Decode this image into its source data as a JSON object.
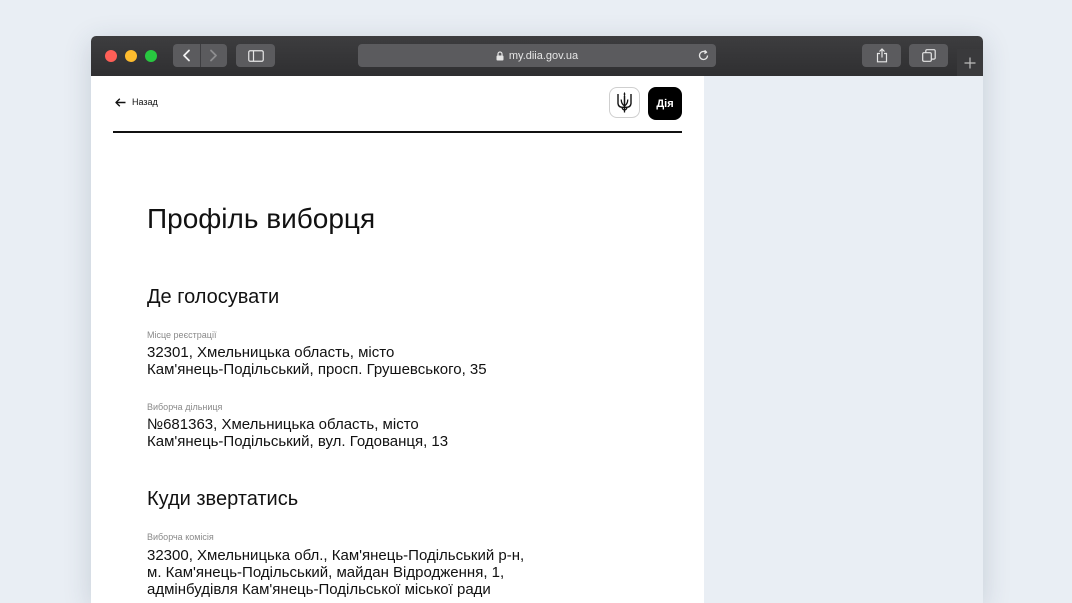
{
  "browser": {
    "url": "my.diia.gov.ua"
  },
  "header": {
    "back_label": "Назад",
    "logo_text": "Дія"
  },
  "page": {
    "title": "Профіль виборця"
  },
  "where_to_vote": {
    "title": "Де голосувати",
    "registration": {
      "label": "Місце реєстрації",
      "lines": [
        "32301, Хмельницька область, місто",
        "Кам'янець-Подільський, просп. Грушевського, 35"
      ]
    },
    "polling_station": {
      "label": "Виборча дільниця",
      "lines": [
        "№681363, Хмельницька область, місто",
        "Кам'янець-Подільський, вул. Годованця, 13"
      ]
    }
  },
  "where_to_apply": {
    "title": "Куди звертатись",
    "commission": {
      "label": "Виборча комісія",
      "lines": [
        "32300, Хмельницька обл., Кам'янець-Подільський р-н,",
        "м. Кам'янець-Подільський, майдан Відродження, 1,",
        "адмінбудівля Кам'янець-Подільської міської ради"
      ]
    }
  },
  "icons": {
    "lock": "lock-icon",
    "reload": "reload-icon",
    "back": "arrow-left-icon",
    "coat_of_arms": "trident-icon",
    "share": "share-icon",
    "tabs": "tabs-icon",
    "sidebar": "sidebar-icon",
    "new_tab": "plus-icon"
  },
  "colors": {
    "traffic_red": "#ff5f57",
    "traffic_yellow": "#febc2e",
    "traffic_green": "#28c840",
    "toolbar": "#333335",
    "desktop": "#e9eef4",
    "logo_bg": "#000000"
  }
}
